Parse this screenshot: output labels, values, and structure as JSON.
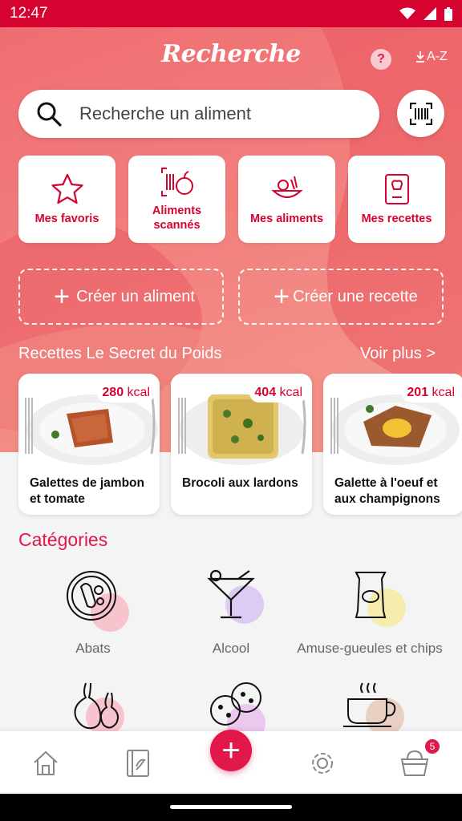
{
  "status": {
    "time": "12:47"
  },
  "header": {
    "title": "Recherche",
    "help_label": "?",
    "sort_label": "A-Z"
  },
  "search": {
    "placeholder": "Recherche un aliment"
  },
  "tiles": [
    {
      "label": "Mes favoris",
      "icon": "star-icon"
    },
    {
      "label": "Aliments scannés",
      "icon": "scan-food-icon"
    },
    {
      "label": "Mes aliments",
      "icon": "food-icon"
    },
    {
      "label": "Mes recettes",
      "icon": "recipe-book-icon"
    }
  ],
  "create": {
    "food_label": "Créer un aliment",
    "recipe_label": "Créer une recette"
  },
  "recipes_section": {
    "title": "Recettes Le Secret du Poids",
    "more_label": "Voir plus >"
  },
  "recipes": [
    {
      "kcal_value": "280",
      "kcal_unit": "kcal",
      "name": "Galettes de jambon et tomate"
    },
    {
      "kcal_value": "404",
      "kcal_unit": "kcal",
      "name": "Brocoli aux lardons"
    },
    {
      "kcal_value": "201",
      "kcal_unit": "kcal",
      "name": "Galette à l'oeuf et aux champignons"
    }
  ],
  "categories": {
    "title": "Catégories",
    "items": [
      {
        "label": "Abats",
        "icon": "sausage-plate-icon",
        "color": "#f7c4cd"
      },
      {
        "label": "Alcool",
        "icon": "cocktail-icon",
        "color": "#dccbf3"
      },
      {
        "label": "Amuse-gueules et chips",
        "icon": "chips-bag-icon",
        "color": "#f6ecae"
      },
      {
        "label": "",
        "icon": "onion-icon",
        "color": "#f7c4cd"
      },
      {
        "label": "",
        "icon": "cookies-icon",
        "color": "#ecc8ee"
      },
      {
        "label": "",
        "icon": "coffee-cup-icon",
        "color": "#eacfc3"
      }
    ]
  },
  "bottom_nav": {
    "badge_count": "5",
    "fab_label": "+"
  },
  "colors": {
    "accent": "#e2174a",
    "status_bar": "#d6022f"
  }
}
